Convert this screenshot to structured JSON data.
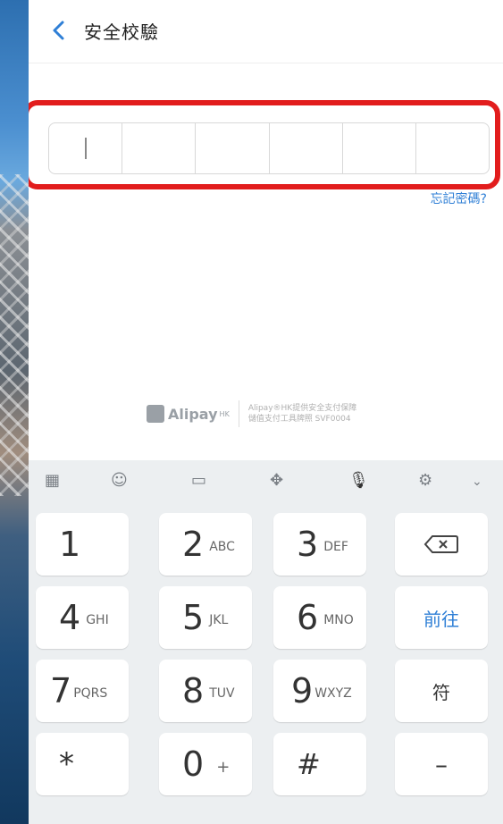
{
  "header": {
    "title": "安全校驗"
  },
  "pin": {
    "cells": 6
  },
  "links": {
    "forgot": "忘記密碼?"
  },
  "branding": {
    "name": "Alipay",
    "name_suffix": "HK",
    "line1": "Alipay®HK提供安全支付保障",
    "line2": "儲值支付工具牌照 SVF0004"
  },
  "keyboard": {
    "rows": [
      [
        {
          "id": "1",
          "num": "1",
          "letters": ""
        },
        {
          "id": "2",
          "num": "2",
          "letters": "ABC"
        },
        {
          "id": "3",
          "num": "3",
          "letters": "DEF"
        },
        {
          "id": "backspace",
          "num": "",
          "letters": ""
        }
      ],
      [
        {
          "id": "4",
          "num": "4",
          "letters": "GHI"
        },
        {
          "id": "5",
          "num": "5",
          "letters": "JKL"
        },
        {
          "id": "6",
          "num": "6",
          "letters": "MNO"
        },
        {
          "id": "go",
          "label": "前往"
        }
      ],
      [
        {
          "id": "7",
          "num": "7",
          "letters": "PQRS"
        },
        {
          "id": "8",
          "num": "8",
          "letters": "TUV"
        },
        {
          "id": "9",
          "num": "9",
          "letters": "WXYZ"
        },
        {
          "id": "symbols",
          "label": "符"
        }
      ],
      [
        {
          "id": "star",
          "label": "*"
        },
        {
          "id": "0",
          "num": "0",
          "letters": "+"
        },
        {
          "id": "hash",
          "label": "#"
        },
        {
          "id": "minus",
          "label": "–"
        }
      ]
    ]
  }
}
